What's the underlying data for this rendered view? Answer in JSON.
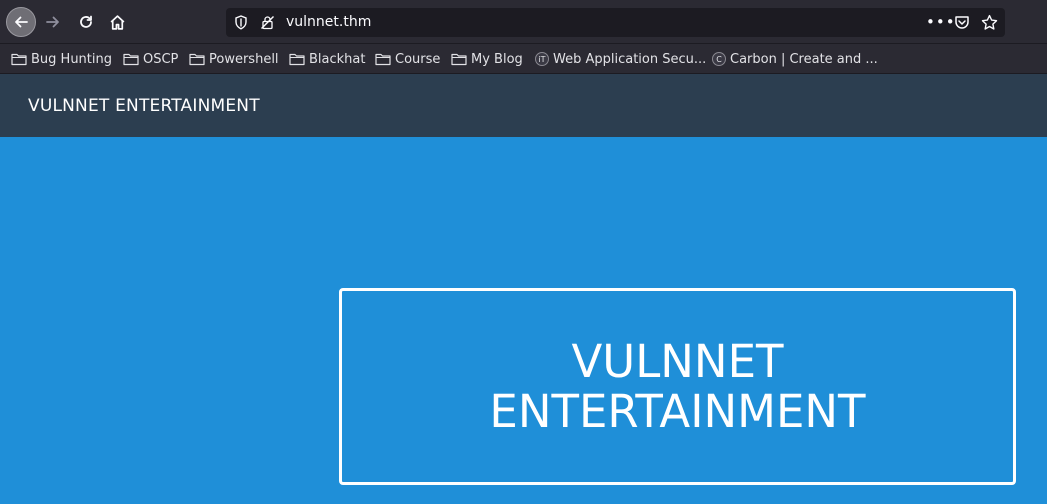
{
  "browser": {
    "url": "vulnnet.thm",
    "more_label": "•••"
  },
  "bookmarks": [
    {
      "label": "Bug Hunting",
      "icon": "folder-icon"
    },
    {
      "label": "OSCP",
      "icon": "folder-icon"
    },
    {
      "label": "Powershell",
      "icon": "folder-icon"
    },
    {
      "label": "Blackhat",
      "icon": "folder-icon"
    },
    {
      "label": "Course",
      "icon": "folder-icon"
    },
    {
      "label": "My Blog",
      "icon": "folder-icon"
    },
    {
      "label": "Web Application Secu...",
      "icon": "site-favicon",
      "favicon_text": "iT"
    },
    {
      "label": "Carbon | Create and ...",
      "icon": "site-favicon",
      "favicon_text": "C"
    }
  ],
  "site": {
    "brand": "VULNNET ENTERTAINMENT",
    "hero_title": "VULNNET ENTERTAINMENT"
  },
  "colors": {
    "toolbar": "#2b2a33",
    "urlbar": "#1c1b22",
    "site_header": "#2c3e50",
    "hero_background": "#1f8fd8",
    "hero_text": "#ffffff"
  }
}
